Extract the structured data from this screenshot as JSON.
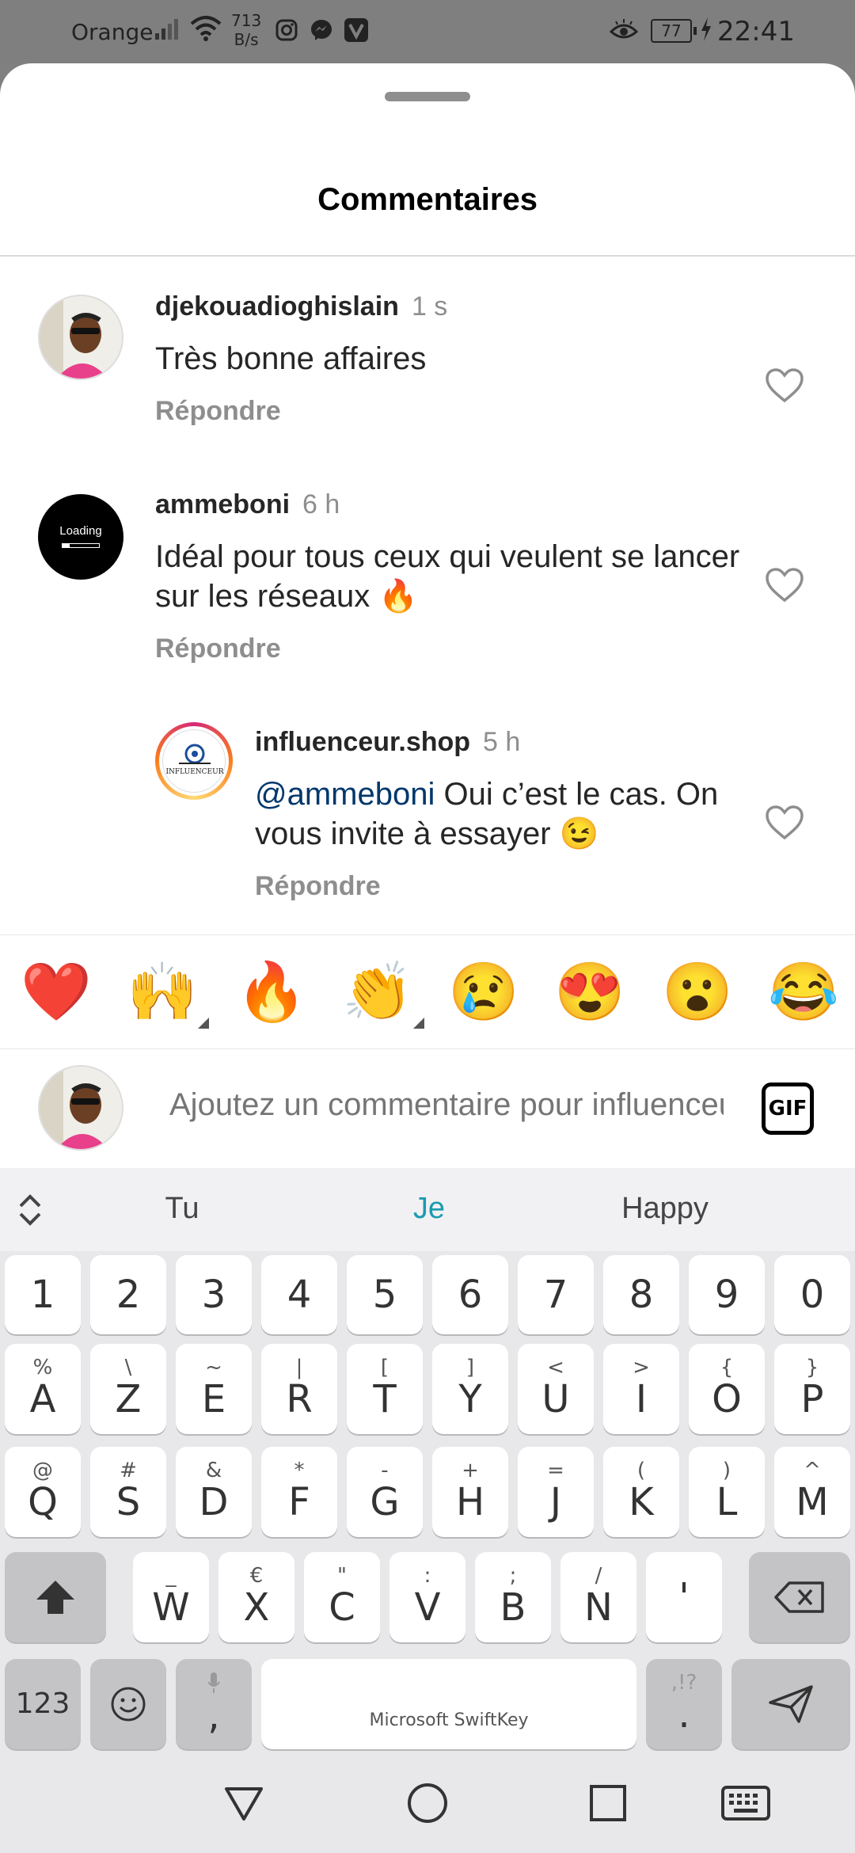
{
  "status_bar": {
    "carrier": "Orange",
    "data_rate": "713",
    "data_rate_unit": "B/s",
    "battery": "77",
    "time": "22:41"
  },
  "sheet": {
    "title": "Commentaires"
  },
  "comments": [
    {
      "username": "djekouadioghislain",
      "time": "1 s",
      "text": "Très bonne affaires",
      "reply_label": "Répondre"
    },
    {
      "username": "ammeboni",
      "avatar_text": "Loading",
      "time": "6 h",
      "text": "Idéal pour tous ceux qui veulent se lancer sur les réseaux 🔥",
      "reply_label": "Répondre"
    },
    {
      "username": "influenceur.shop",
      "avatar_text": "INFLUENCEUR",
      "time": "5 h",
      "mention": "@ammeboni",
      "text": " Oui c’est le cas. On vous invite à essayer 😉",
      "reply_label": "Répondre"
    }
  ],
  "emoji_bar": [
    "❤️",
    "🙌",
    "🔥",
    "👏",
    "😢",
    "😍",
    "😮",
    "😂"
  ],
  "input": {
    "placeholder": "Ajoutez un commentaire pour influenceur.shop…",
    "gif_label": "GIF"
  },
  "keyboard": {
    "suggestions": [
      "Tu",
      "Je",
      "Happy"
    ],
    "number_row": [
      "1",
      "2",
      "3",
      "4",
      "5",
      "6",
      "7",
      "8",
      "9",
      "0"
    ],
    "row1": [
      {
        "main": "A",
        "sub": "%"
      },
      {
        "main": "Z",
        "sub": "\\"
      },
      {
        "main": "E",
        "sub": "~"
      },
      {
        "main": "R",
        "sub": "|"
      },
      {
        "main": "T",
        "sub": "["
      },
      {
        "main": "Y",
        "sub": "]"
      },
      {
        "main": "U",
        "sub": "<"
      },
      {
        "main": "I",
        "sub": ">"
      },
      {
        "main": "O",
        "sub": "{"
      },
      {
        "main": "P",
        "sub": "}"
      }
    ],
    "row2": [
      {
        "main": "Q",
        "sub": "@"
      },
      {
        "main": "S",
        "sub": "#"
      },
      {
        "main": "D",
        "sub": "&"
      },
      {
        "main": "F",
        "sub": "*"
      },
      {
        "main": "G",
        "sub": "-"
      },
      {
        "main": "H",
        "sub": "+"
      },
      {
        "main": "J",
        "sub": "="
      },
      {
        "main": "K",
        "sub": "("
      },
      {
        "main": "L",
        "sub": ")"
      },
      {
        "main": "M",
        "sub": "^"
      }
    ],
    "row3": [
      {
        "main": "W",
        "sub": "_"
      },
      {
        "main": "X",
        "sub": "€"
      },
      {
        "main": "C",
        "sub": "\""
      },
      {
        "main": "V",
        "sub": ":"
      },
      {
        "main": "B",
        "sub": ";"
      },
      {
        "main": "N",
        "sub": "/"
      },
      {
        "main": "'",
        "sub": ""
      }
    ],
    "numbers_label": "123",
    "comma_label": ",",
    "period_label": ".",
    "period_sub": ",!?",
    "space_label": "Microsoft SwiftKey"
  }
}
